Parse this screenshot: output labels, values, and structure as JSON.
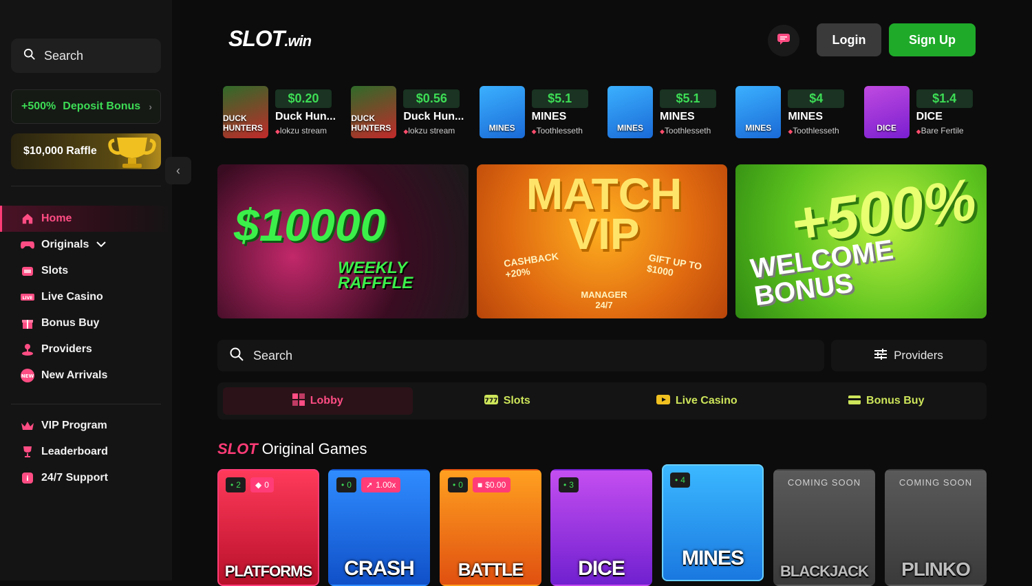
{
  "sidebar": {
    "search_label": "Search",
    "deposit": {
      "percent": "+500%",
      "label": "Deposit Bonus"
    },
    "raffle_label": "$10,000 Raffle",
    "nav_main": [
      {
        "label": "Home",
        "icon": "home-icon"
      },
      {
        "label": "Originals",
        "icon": "gamepad-icon"
      },
      {
        "label": "Slots",
        "icon": "slots-icon"
      },
      {
        "label": "Live Casino",
        "icon": "live-icon"
      },
      {
        "label": "Bonus Buy",
        "icon": "gift-icon"
      },
      {
        "label": "Providers",
        "icon": "joystick-icon"
      },
      {
        "label": "New Arrivals",
        "icon": "new-icon"
      }
    ],
    "nav_secondary": [
      {
        "label": "VIP Program",
        "icon": "crown-icon"
      },
      {
        "label": "Leaderboard",
        "icon": "trophy-icon"
      },
      {
        "label": "24/7 Support",
        "icon": "support-icon"
      }
    ]
  },
  "header": {
    "logo_main": "SLOT",
    "logo_suffix": ".win",
    "login_label": "Login",
    "signup_label": "Sign Up"
  },
  "recent_wins": [
    {
      "amount": "$0.20",
      "game": "Duck Hun...",
      "user": "lokzu stream",
      "thumb": "DUCK HUNTERS"
    },
    {
      "amount": "$0.56",
      "game": "Duck Hun...",
      "user": "lokzu stream",
      "thumb": "DUCK HUNTERS"
    },
    {
      "amount": "$5.1",
      "game": "MINES",
      "user": "Toothlesseth",
      "thumb": "MINES"
    },
    {
      "amount": "$5.1",
      "game": "MINES",
      "user": "Toothlesseth",
      "thumb": "MINES"
    },
    {
      "amount": "$4",
      "game": "MINES",
      "user": "Toothlesseth",
      "thumb": "MINES"
    },
    {
      "amount": "$1.4",
      "game": "DICE",
      "user": "Bare Fertile",
      "thumb": "DICE"
    }
  ],
  "banners": [
    {
      "title": "$10000",
      "subtitle": "WEEKLY RAFFFLE"
    },
    {
      "title": "MATCH VIP",
      "badge1": "CASHBACK +20%",
      "badge2": "GIFT UP TO $1000",
      "badge3": "MANAGER 24/7"
    },
    {
      "title": "+500%",
      "subtitle": "WELCOME BONUS"
    }
  ],
  "lobby": {
    "search_label": "Search",
    "providers_label": "Providers",
    "tabs": [
      {
        "label": "Lobby",
        "icon": "lobby-icon"
      },
      {
        "label": "Slots",
        "icon": "slots-icon"
      },
      {
        "label": "Live Casino",
        "icon": "live-icon"
      },
      {
        "label": "Bonus Buy",
        "icon": "bonus-icon"
      }
    ]
  },
  "originals": {
    "title_brand": "SLOT",
    "title_text": "Original Games",
    "games": [
      {
        "name": "PLATFORMS",
        "players": "2",
        "extra": "0"
      },
      {
        "name": "CRASH",
        "players": "0",
        "extra": "1.00x"
      },
      {
        "name": "BATTLE",
        "players": "0",
        "extra": "$0.00"
      },
      {
        "name": "DICE",
        "players": "3",
        "extra": ""
      },
      {
        "name": "MINES",
        "players": "4",
        "extra": ""
      },
      {
        "name": "BLACKJACK",
        "soon": "COMING SOON"
      },
      {
        "name": "PLINKO",
        "soon": "COMING SOON"
      }
    ]
  },
  "colors": {
    "accent_pink": "#ff3c77",
    "accent_green": "#1faa2a",
    "win_green": "#3ddc55",
    "tab_yellow": "#cde55a"
  }
}
